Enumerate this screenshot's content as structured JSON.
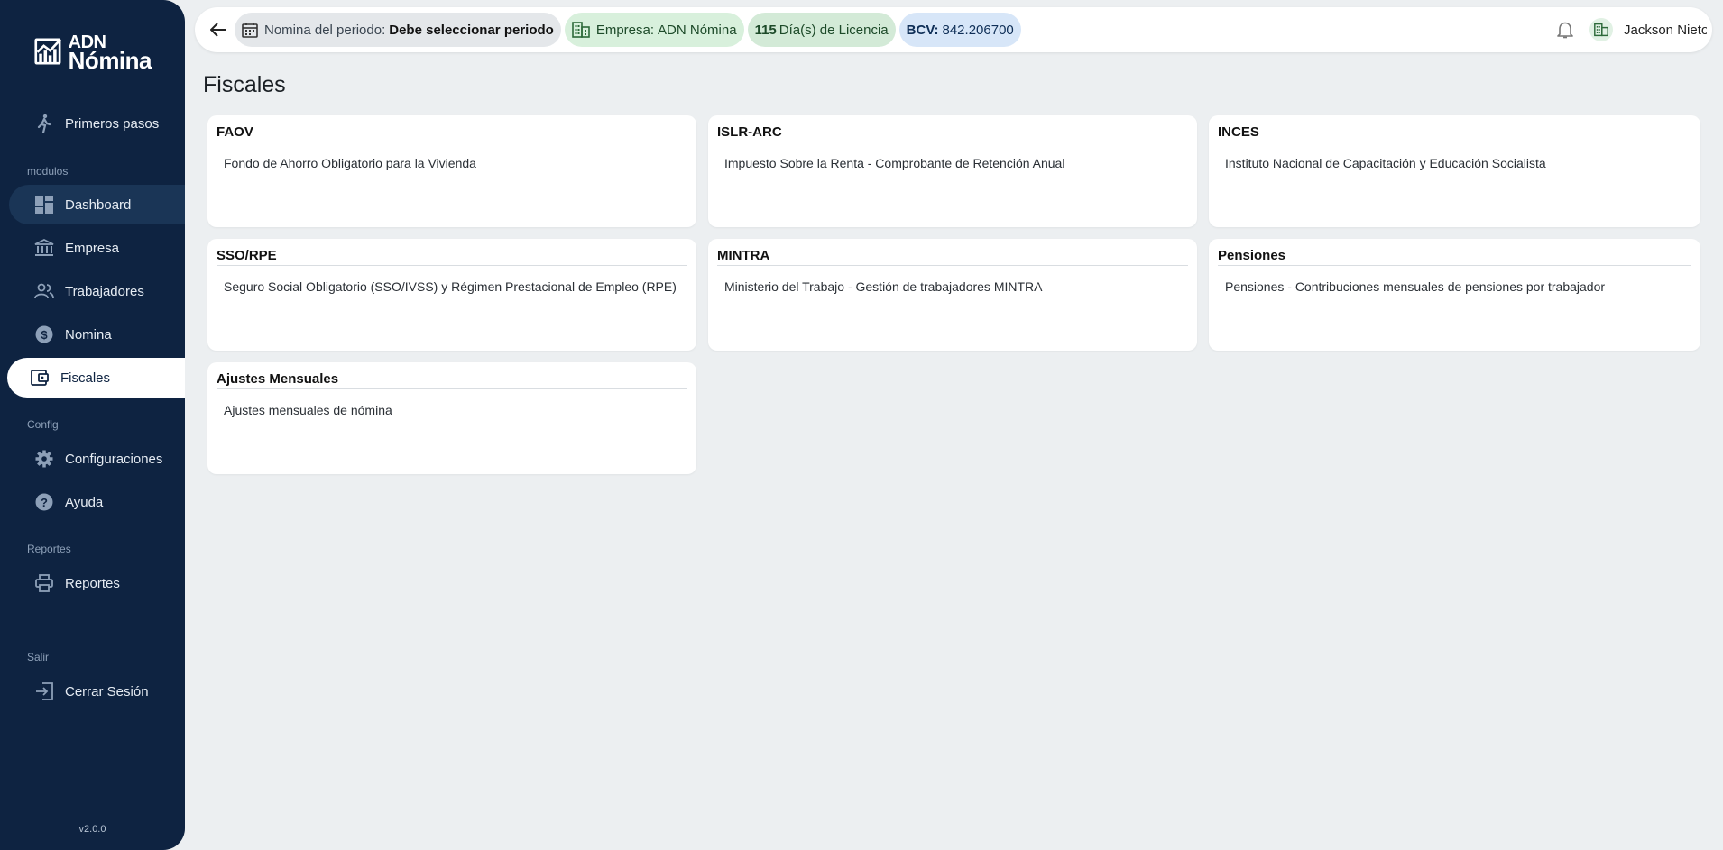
{
  "app": {
    "logo_line1": "ADN",
    "logo_line2": "Nómina",
    "version": "v2.0.0"
  },
  "sidebar": {
    "top_item": {
      "label": "Primeros pasos",
      "icon": "walking-icon"
    },
    "sections": [
      {
        "title": "modulos"
      },
      {
        "title": "Config"
      },
      {
        "title": "Reportes"
      },
      {
        "title": "Salir"
      }
    ],
    "items": [
      {
        "label": "Dashboard",
        "icon": "dashboard-icon"
      },
      {
        "label": "Empresa",
        "icon": "bank-icon"
      },
      {
        "label": "Trabajadores",
        "icon": "people-icon"
      },
      {
        "label": "Nomina",
        "icon": "dollar-icon"
      },
      {
        "label": "Fiscales",
        "icon": "wallet-icon"
      },
      {
        "label": "Configuraciones",
        "icon": "gear-icon"
      },
      {
        "label": "Ayuda",
        "icon": "help-icon"
      },
      {
        "label": "Reportes",
        "icon": "printer-icon"
      },
      {
        "label": "Cerrar Sesión",
        "icon": "logout-icon"
      }
    ],
    "active": "Fiscales"
  },
  "topbar": {
    "period_label": "Nomina del periodo:",
    "period_value": "Debe seleccionar periodo",
    "company_label": "Empresa:",
    "company_value": "ADN Nómina",
    "license_count": "115",
    "license_label": "Día(s) de Licencia",
    "bcv_label": "BCV:",
    "bcv_value": "842.206700",
    "user_name": "Jackson Nieto"
  },
  "page": {
    "title": "Fiscales",
    "cards": [
      {
        "title": "FAOV",
        "description": "Fondo de Ahorro Obligatorio para la Vivienda"
      },
      {
        "title": "ISLR-ARC",
        "description": "Impuesto Sobre la Renta - Comprobante de Retención Anual"
      },
      {
        "title": "INCES",
        "description": "Instituto Nacional de Capacitación y Educación Socialista"
      },
      {
        "title": "SSO/RPE",
        "description": "Seguro Social Obligatorio (SSO/IVSS) y Régimen Prestacional de Empleo (RPE)"
      },
      {
        "title": "MINTRA",
        "description": "Ministerio del Trabajo - Gestión de trabajadores MINTRA"
      },
      {
        "title": "Pensiones",
        "description": "Pensiones - Contribuciones mensuales de pensiones por trabajador"
      },
      {
        "title": "Ajustes Mensuales",
        "description": "Ajustes mensuales de nómina"
      }
    ]
  },
  "colors": {
    "sidebar_bg": "#0e2341",
    "page_bg": "#eceff1",
    "chip_green": "#d8f0dc",
    "chip_blue": "#d7e6f8"
  }
}
